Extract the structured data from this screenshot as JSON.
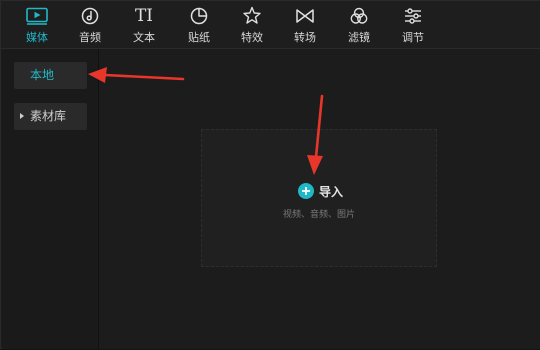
{
  "toolbar": {
    "tabs": [
      {
        "label": "媒体",
        "icon": "media-play-icon",
        "active": true
      },
      {
        "label": "音频",
        "icon": "audio-note-icon",
        "active": false
      },
      {
        "label": "文本",
        "icon": "text-ti-icon",
        "active": false
      },
      {
        "label": "贴纸",
        "icon": "sticker-icon",
        "active": false
      },
      {
        "label": "特效",
        "icon": "effect-star-icon",
        "active": false
      },
      {
        "label": "转场",
        "icon": "transition-bowtie-icon",
        "active": false
      },
      {
        "label": "滤镜",
        "icon": "filter-circles-icon",
        "active": false
      },
      {
        "label": "调节",
        "icon": "adjust-sliders-icon",
        "active": false
      }
    ],
    "text_icon_glyph": "TI"
  },
  "sidebar": {
    "items": [
      {
        "label": "本地",
        "active": true
      },
      {
        "label": "素材库",
        "active": false,
        "expandable": true
      }
    ]
  },
  "main": {
    "import_label": "导入",
    "import_hint": "视频、音频、图片"
  },
  "annotations": {
    "arrow_color": "#e8362a"
  },
  "colors": {
    "accent": "#22b8c8",
    "background": "#1c1c1c"
  }
}
